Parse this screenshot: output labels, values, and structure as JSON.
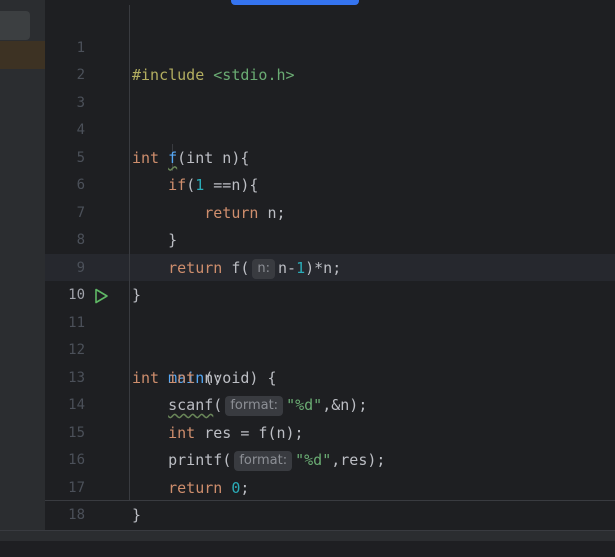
{
  "editor": {
    "lines": [
      {
        "n": "1"
      },
      {
        "n": "2"
      },
      {
        "n": "3"
      },
      {
        "n": "4"
      },
      {
        "n": "5"
      },
      {
        "n": "6"
      },
      {
        "n": "7"
      },
      {
        "n": "8"
      },
      {
        "n": "9"
      },
      {
        "n": "10"
      },
      {
        "n": "11"
      },
      {
        "n": "12"
      },
      {
        "n": "13"
      },
      {
        "n": "14"
      },
      {
        "n": "15"
      },
      {
        "n": "16"
      },
      {
        "n": "17"
      },
      {
        "n": "18"
      }
    ],
    "code": {
      "l1_directive": "#include",
      "l1_header": "<stdio.h>",
      "l4_kw": "int",
      "l4_fn": "f",
      "l4_rest": "(int n){",
      "l5_kw": "if",
      "l5_open": "(",
      "l5_num": "1",
      "l5_rest": " ==n){",
      "l6_kw": "return",
      "l6_rest": " n;",
      "l7_text": "}",
      "l8_kw": "return",
      "l8_call": " f(",
      "l8_hint": "n:",
      "l8_mid": "n-",
      "l8_num": "1",
      "l8_rest": ")*n;",
      "l9_text": "}",
      "l11_kw": "int",
      "l11_fn": "main",
      "l11_rest": "(void) {",
      "l12_kw": "int",
      "l12_rest": " n;",
      "l13_fn": "scanf",
      "l13_open": "(",
      "l13_hint": "format:",
      "l13_str": "\"%d\"",
      "l13_rest": ",&n);",
      "l14_kw": "int",
      "l14_rest": " res = f(n);",
      "l15_fn": "printf",
      "l15_open": "(",
      "l15_hint": "format:",
      "l15_str": "\"%d\"",
      "l15_rest": ",res);",
      "l16_kw": "return",
      "l16_num": "0",
      "l16_rest": ";",
      "l17_text": "}"
    },
    "run_icon": "run-triangle-icon",
    "colors": {
      "background": "#1e1f22",
      "keyword": "#cf8e6d",
      "function": "#56a8f5",
      "string": "#6aab73",
      "number": "#2aacb8",
      "run_icon": "#5fb865"
    }
  }
}
